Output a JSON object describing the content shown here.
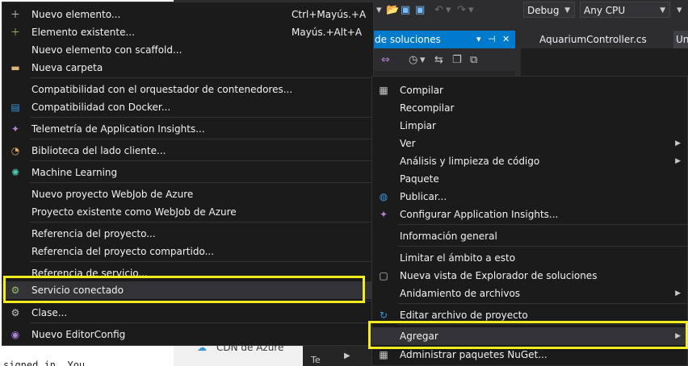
{
  "background": {
    "left_code": "signed in. You",
    "mid_item_label": "CDN de Azure",
    "se_bottom_text": "Te"
  },
  "toolbar": {
    "config": "Debug",
    "platform": "Any CPU"
  },
  "tabs": {
    "solution_explorer": "de soluciones",
    "controller": "AquariumController.cs",
    "third": "Un"
  },
  "left_menu": {
    "items": [
      {
        "label": "Nuevo elemento...",
        "shortcut": "Ctrl+Mayús.+A",
        "icon": "new-item-icon"
      },
      {
        "label": "Elemento existente...",
        "shortcut": "Mayús.+Alt+A",
        "icon": "existing-item-icon"
      },
      {
        "label": "Nuevo elemento con scaffold...",
        "shortcut": "",
        "icon": ""
      },
      {
        "label": "Nueva carpeta",
        "shortcut": "",
        "icon": "folder-icon"
      },
      {
        "label": "Compatibilidad con el orquestador de contenedores...",
        "shortcut": "",
        "icon": ""
      },
      {
        "label": "Compatibilidad con Docker...",
        "shortcut": "",
        "icon": "docker-icon"
      },
      {
        "label": "Telemetría de Application Insights...",
        "shortcut": "",
        "icon": "app-insights-icon"
      },
      {
        "label": "Biblioteca del lado cliente...",
        "shortcut": "",
        "icon": "client-library-icon"
      },
      {
        "label": "Machine Learning",
        "shortcut": "",
        "icon": "machine-learning-icon"
      },
      {
        "label": "Nuevo proyecto WebJob de Azure",
        "shortcut": "",
        "icon": ""
      },
      {
        "label": "Proyecto existente como WebJob de Azure",
        "shortcut": "",
        "icon": ""
      },
      {
        "label": "Referencia del proyecto...",
        "shortcut": "",
        "icon": ""
      },
      {
        "label": "Referencia del proyecto compartido...",
        "shortcut": "",
        "icon": ""
      },
      {
        "label": "Referencia de servicio...",
        "shortcut": "",
        "icon": ""
      },
      {
        "label": "Servicio conectado",
        "shortcut": "",
        "icon": "connected-service-icon"
      },
      {
        "label": "Clase...",
        "shortcut": "",
        "icon": "class-icon"
      },
      {
        "label": "Nuevo EditorConfig",
        "shortcut": "",
        "icon": "editorconfig-icon"
      }
    ]
  },
  "right_menu": {
    "items": [
      {
        "label": "Compilar",
        "icon": "build-icon",
        "submenu": false
      },
      {
        "label": "Recompilar",
        "icon": "",
        "submenu": false
      },
      {
        "label": "Limpiar",
        "icon": "",
        "submenu": false
      },
      {
        "label": "Ver",
        "icon": "",
        "submenu": true
      },
      {
        "label": "Análisis y limpieza de código",
        "icon": "",
        "submenu": true
      },
      {
        "label": "Paquete",
        "icon": "",
        "submenu": false
      },
      {
        "label": "Publicar...",
        "icon": "globe-icon",
        "submenu": false
      },
      {
        "label": "Configurar Application Insights...",
        "icon": "app-insights-icon",
        "submenu": false
      },
      {
        "label": "Información general",
        "icon": "",
        "submenu": false
      },
      {
        "label": "Limitar el ámbito a esto",
        "icon": "",
        "submenu": false
      },
      {
        "label": "Nueva vista de Explorador de soluciones",
        "icon": "new-view-icon",
        "submenu": false
      },
      {
        "label": "Anidamiento de archivos",
        "icon": "",
        "submenu": true
      },
      {
        "label": "Editar archivo de proyecto",
        "icon": "refresh-arrow-icon",
        "submenu": false
      },
      {
        "label": "Agregar",
        "icon": "",
        "submenu": true
      },
      {
        "label": "Administrar paquetes NuGet...",
        "icon": "nuget-icon",
        "submenu": false
      }
    ]
  },
  "colors": {
    "menu_bg": "#1b1b1c",
    "highlight": "#333337",
    "callout": "#f5ec1f",
    "accent": "#007acc"
  }
}
